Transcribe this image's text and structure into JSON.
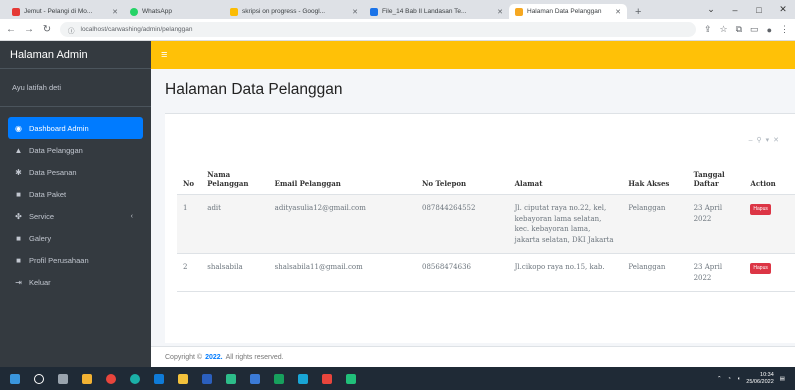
{
  "browser": {
    "tabs": [
      {
        "label": "Jemut - Pelangi di Mo...",
        "active": false,
        "color": "#e53935"
      },
      {
        "label": "WhatsApp",
        "active": false,
        "color": "#25d366"
      },
      {
        "label": "skripsi on progress - Googl...",
        "active": false,
        "color": "#fbbc04"
      },
      {
        "label": "File_14 Bab II Landasan Te...",
        "active": false,
        "color": "#1a73e8"
      },
      {
        "label": "Halaman Data Pelanggan",
        "active": true,
        "color": "#f6a821"
      }
    ],
    "url": "localhost/carwashing/admin/pelanggan"
  },
  "sidebar": {
    "brand": "Halaman Admin",
    "user": "Ayu latifah deti",
    "items": [
      {
        "label": "Dashboard Admin",
        "icon": "palette-icon",
        "glyph": "◉",
        "active": true
      },
      {
        "label": "Data Pelanggan",
        "icon": "user-icon",
        "glyph": "▲",
        "active": false
      },
      {
        "label": "Data Pesanan",
        "icon": "star-icon",
        "glyph": "✱",
        "active": false
      },
      {
        "label": "Data Paket",
        "icon": "list-icon",
        "glyph": "■",
        "active": false
      },
      {
        "label": "Service",
        "icon": "users-icon",
        "glyph": "✤",
        "active": false,
        "caret": "‹"
      },
      {
        "label": "Galery",
        "icon": "image-icon",
        "glyph": "■",
        "active": false
      },
      {
        "label": "Profil Perusahaan",
        "icon": "building-icon",
        "glyph": "■",
        "active": false
      },
      {
        "label": "Keluar",
        "icon": "logout-icon",
        "glyph": "⇥",
        "active": false
      }
    ]
  },
  "main": {
    "title": "Halaman Data Pelanggan",
    "table": {
      "headers": [
        "No",
        "Nama Pelanggan",
        "Email Pelanggan",
        "No Telepon",
        "Alamat",
        "Hak Akses",
        "Tanggal Daftar",
        "Action"
      ],
      "rows": [
        {
          "no": "1",
          "nama": "adit",
          "email": "adityasulia12@gmail.com",
          "telepon": "087844264552",
          "alamat": "Jl. ciputat raya no.22, kel, kebayoran lama selatan, kec. kebayoran lama, jakarta selatan, DKI Jakarta",
          "akses": "Pelanggan",
          "tanggal": "23 April 2022",
          "action": "Hapus"
        },
        {
          "no": "2",
          "nama": "shalsabila",
          "email": "shalsabila11@gmail.com",
          "telepon": "08568474636",
          "alamat": "Jl.cikopo raya no.15, kab.",
          "akses": "Pelanggan",
          "tanggal": "23 April 2022",
          "action": "Hapus"
        }
      ]
    }
  },
  "footer": {
    "prefix": "Copyright ©",
    "year": "2022.",
    "suffix": "All rights reserved."
  },
  "taskbar": {
    "time": "10:34",
    "date": "25/06/2022"
  },
  "colors": {
    "sidebar": "#343a40",
    "topbar": "#ffc107",
    "primary": "#007bff",
    "danger": "#dc3545"
  }
}
